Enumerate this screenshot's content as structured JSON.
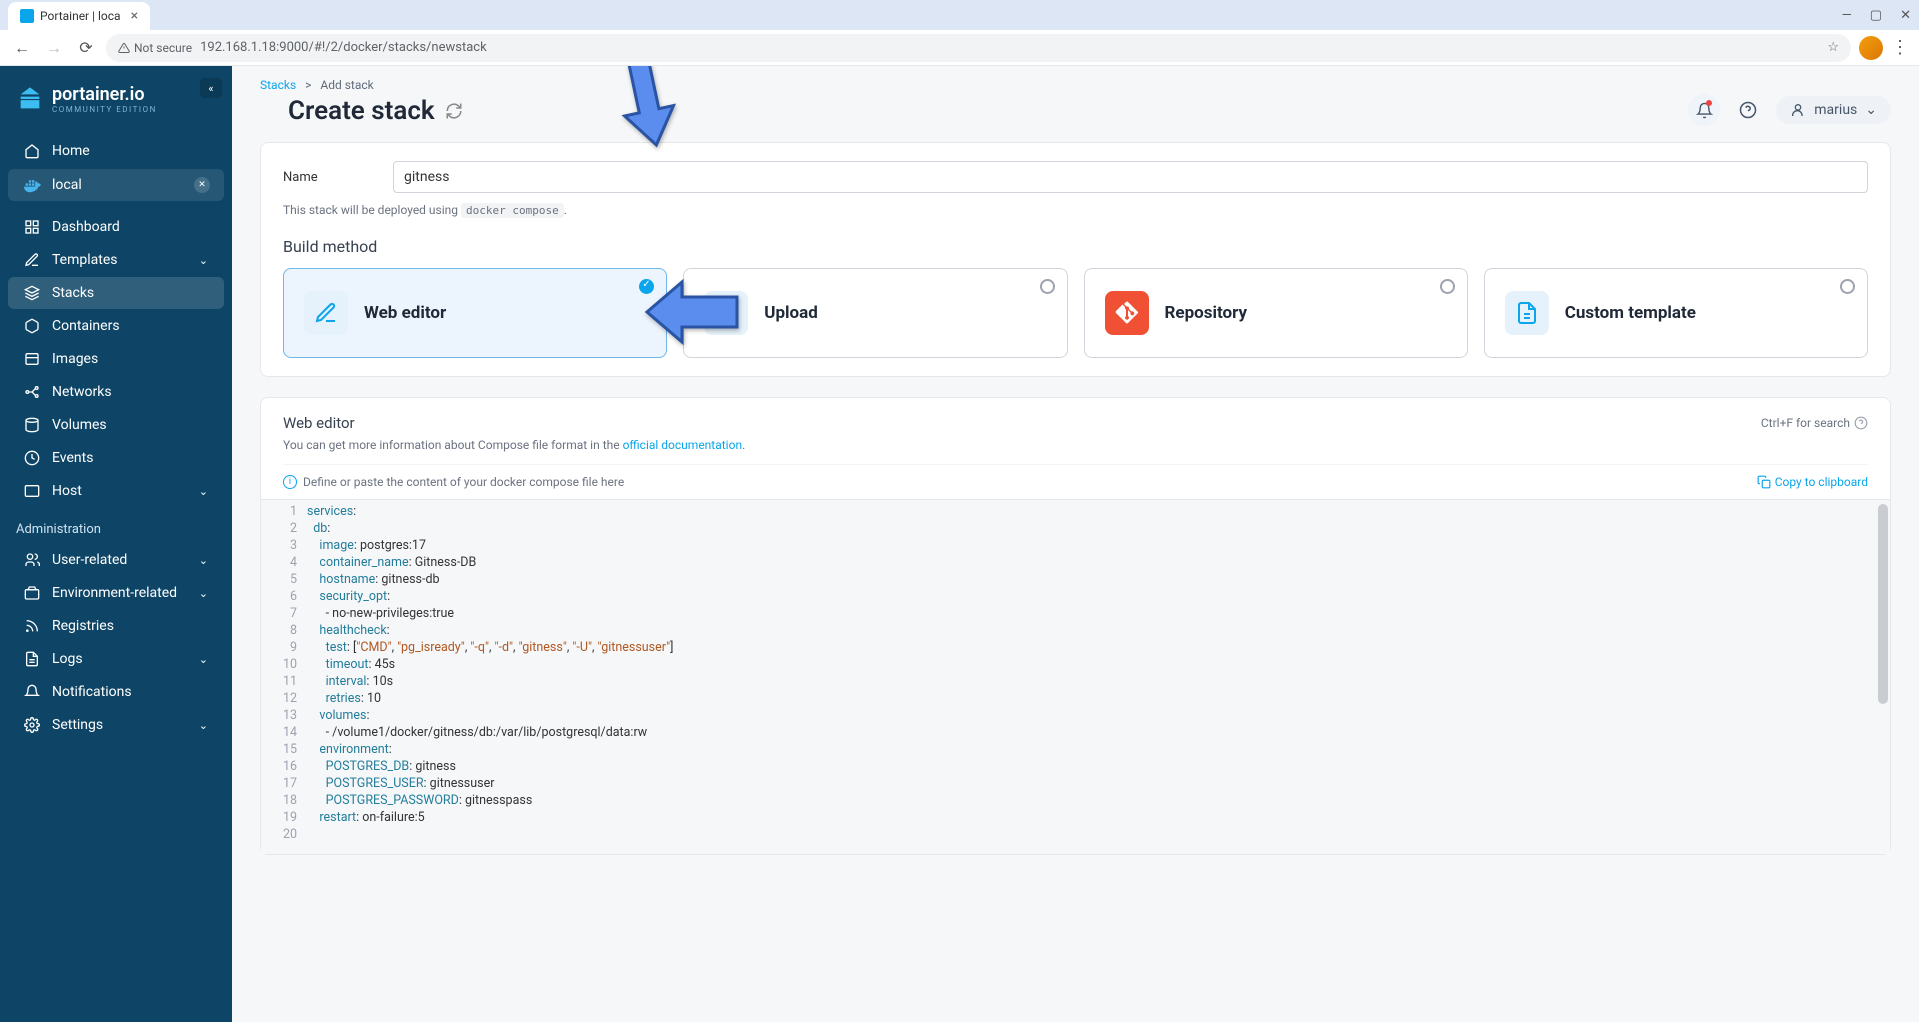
{
  "browser": {
    "tab_title": "Portainer | loca",
    "url": "192.168.1.18:9000/#!/2/docker/stacks/newstack",
    "not_secure": "Not secure"
  },
  "brand": {
    "name": "portainer.io",
    "edition": "COMMUNITY EDITION"
  },
  "sidebar": {
    "home": "Home",
    "env": "local",
    "items": [
      "Dashboard",
      "Templates",
      "Stacks",
      "Containers",
      "Images",
      "Networks",
      "Volumes",
      "Events",
      "Host"
    ],
    "admin_label": "Administration",
    "admin_items": [
      "User-related",
      "Environment-related",
      "Registries",
      "Logs",
      "Notifications",
      "Settings"
    ]
  },
  "breadcrumb": {
    "stacks": "Stacks",
    "sep": ">",
    "current": "Add stack"
  },
  "page_title": "Create stack",
  "user": {
    "name": "marius"
  },
  "form": {
    "name_label": "Name",
    "name_value": "gitness",
    "hint_prefix": "This stack will be deployed using",
    "hint_code": "docker compose",
    "hint_suffix": "."
  },
  "build": {
    "title": "Build method",
    "methods": [
      "Web editor",
      "Upload",
      "Repository",
      "Custom template"
    ]
  },
  "editor": {
    "title": "Web editor",
    "search_hint": "Ctrl+F for search",
    "desc_prefix": "You can get more information about Compose file format in the ",
    "desc_link": "official documentation",
    "desc_suffix": ".",
    "placeholder_hint": "Define or paste the content of your docker compose file here",
    "copy": "Copy to clipboard"
  },
  "code": {
    "lines": [
      {
        "n": 1,
        "tokens": [
          [
            "key",
            "services"
          ],
          [
            "punc",
            ":"
          ]
        ]
      },
      {
        "n": 2,
        "tokens": [
          [
            "ws",
            "  "
          ],
          [
            "key",
            "db"
          ],
          [
            "punc",
            ":"
          ]
        ]
      },
      {
        "n": 3,
        "tokens": [
          [
            "ws",
            "    "
          ],
          [
            "key",
            "image"
          ],
          [
            "punc",
            ": "
          ],
          [
            "txt",
            "postgres:17"
          ]
        ]
      },
      {
        "n": 4,
        "tokens": [
          [
            "ws",
            "    "
          ],
          [
            "key",
            "container_name"
          ],
          [
            "punc",
            ": "
          ],
          [
            "txt",
            "Gitness-DB"
          ]
        ]
      },
      {
        "n": 5,
        "tokens": [
          [
            "ws",
            "    "
          ],
          [
            "key",
            "hostname"
          ],
          [
            "punc",
            ": "
          ],
          [
            "txt",
            "gitness-db"
          ]
        ]
      },
      {
        "n": 6,
        "tokens": [
          [
            "ws",
            "    "
          ],
          [
            "key",
            "security_opt"
          ],
          [
            "punc",
            ":"
          ]
        ]
      },
      {
        "n": 7,
        "tokens": [
          [
            "ws",
            "      "
          ],
          [
            "punc",
            "- "
          ],
          [
            "txt",
            "no-new-privileges:true"
          ]
        ]
      },
      {
        "n": 8,
        "tokens": [
          [
            "ws",
            "    "
          ],
          [
            "key",
            "healthcheck"
          ],
          [
            "punc",
            ":"
          ]
        ]
      },
      {
        "n": 9,
        "tokens": [
          [
            "ws",
            "      "
          ],
          [
            "key",
            "test"
          ],
          [
            "punc",
            ": ["
          ],
          [
            "str",
            "\"CMD\""
          ],
          [
            "punc",
            ", "
          ],
          [
            "str",
            "\"pg_isready\""
          ],
          [
            "punc",
            ", "
          ],
          [
            "str",
            "\"-q\""
          ],
          [
            "punc",
            ", "
          ],
          [
            "str",
            "\"-d\""
          ],
          [
            "punc",
            ", "
          ],
          [
            "str",
            "\"gitness\""
          ],
          [
            "punc",
            ", "
          ],
          [
            "str",
            "\"-U\""
          ],
          [
            "punc",
            ", "
          ],
          [
            "str",
            "\"gitnessuser\""
          ],
          [
            "punc",
            "]"
          ]
        ]
      },
      {
        "n": 10,
        "tokens": [
          [
            "ws",
            "      "
          ],
          [
            "key",
            "timeout"
          ],
          [
            "punc",
            ": "
          ],
          [
            "txt",
            "45s"
          ]
        ]
      },
      {
        "n": 11,
        "tokens": [
          [
            "ws",
            "      "
          ],
          [
            "key",
            "interval"
          ],
          [
            "punc",
            ": "
          ],
          [
            "txt",
            "10s"
          ]
        ]
      },
      {
        "n": 12,
        "tokens": [
          [
            "ws",
            "      "
          ],
          [
            "key",
            "retries"
          ],
          [
            "punc",
            ": "
          ],
          [
            "txt",
            "10"
          ]
        ]
      },
      {
        "n": 13,
        "tokens": [
          [
            "ws",
            "    "
          ],
          [
            "key",
            "volumes"
          ],
          [
            "punc",
            ":"
          ]
        ]
      },
      {
        "n": 14,
        "tokens": [
          [
            "ws",
            "      "
          ],
          [
            "punc",
            "- "
          ],
          [
            "txt",
            "/volume1/docker/gitness/db:/var/lib/postgresql/data:rw"
          ]
        ]
      },
      {
        "n": 15,
        "tokens": [
          [
            "ws",
            "    "
          ],
          [
            "key",
            "environment"
          ],
          [
            "punc",
            ":"
          ]
        ]
      },
      {
        "n": 16,
        "tokens": [
          [
            "ws",
            "      "
          ],
          [
            "key",
            "POSTGRES_DB"
          ],
          [
            "punc",
            ": "
          ],
          [
            "txt",
            "gitness"
          ]
        ]
      },
      {
        "n": 17,
        "tokens": [
          [
            "ws",
            "      "
          ],
          [
            "key",
            "POSTGRES_USER"
          ],
          [
            "punc",
            ": "
          ],
          [
            "txt",
            "gitnessuser"
          ]
        ]
      },
      {
        "n": 18,
        "tokens": [
          [
            "ws",
            "      "
          ],
          [
            "key",
            "POSTGRES_PASSWORD"
          ],
          [
            "punc",
            ": "
          ],
          [
            "txt",
            "gitnesspass"
          ]
        ]
      },
      {
        "n": 19,
        "tokens": [
          [
            "ws",
            "    "
          ],
          [
            "key",
            "restart"
          ],
          [
            "punc",
            ": "
          ],
          [
            "txt",
            "on-failure:5"
          ]
        ]
      },
      {
        "n": 20,
        "tokens": []
      }
    ]
  }
}
